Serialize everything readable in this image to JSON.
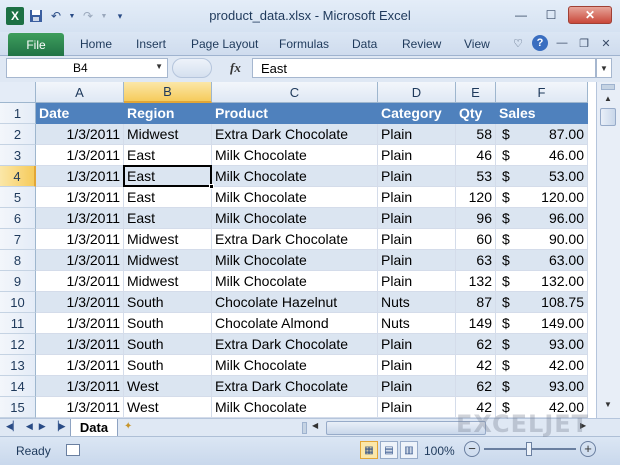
{
  "window": {
    "title": "product_data.xlsx - Microsoft Excel",
    "app_icon": "excel-logo",
    "qat_icons": [
      "save-icon",
      "undo-icon",
      "redo-icon",
      "customize-icon"
    ],
    "buttons": [
      "minimize",
      "maximize",
      "close"
    ]
  },
  "ribbon": {
    "file_label": "File",
    "tabs": [
      "Home",
      "Insert",
      "Page Layout",
      "Formulas",
      "Data",
      "Review",
      "View"
    ]
  },
  "formula_bar": {
    "name_box": "B4",
    "fx": "fx",
    "value": "East"
  },
  "grid": {
    "columns": [
      "A",
      "B",
      "C",
      "D",
      "E",
      "F"
    ],
    "selected_column": "B",
    "selected_row": "4",
    "rows": [
      {
        "n": "1",
        "date": "Date",
        "region": "Region",
        "product": "Product",
        "category": "Category",
        "qty": "Qty",
        "dollar": "",
        "sales": "Sales"
      },
      {
        "n": "2",
        "date": "1/3/2011",
        "region": "Midwest",
        "product": "Extra Dark Chocolate",
        "category": "Plain",
        "qty": "58",
        "dollar": "$",
        "sales": "87.00"
      },
      {
        "n": "3",
        "date": "1/3/2011",
        "region": "East",
        "product": "Milk Chocolate",
        "category": "Plain",
        "qty": "46",
        "dollar": "$",
        "sales": "46.00"
      },
      {
        "n": "4",
        "date": "1/3/2011",
        "region": "East",
        "product": "Milk Chocolate",
        "category": "Plain",
        "qty": "53",
        "dollar": "$",
        "sales": "53.00"
      },
      {
        "n": "5",
        "date": "1/3/2011",
        "region": "East",
        "product": "Milk Chocolate",
        "category": "Plain",
        "qty": "120",
        "dollar": "$",
        "sales": "120.00"
      },
      {
        "n": "6",
        "date": "1/3/2011",
        "region": "East",
        "product": "Milk Chocolate",
        "category": "Plain",
        "qty": "96",
        "dollar": "$",
        "sales": "96.00"
      },
      {
        "n": "7",
        "date": "1/3/2011",
        "region": "Midwest",
        "product": "Extra Dark Chocolate",
        "category": "Plain",
        "qty": "60",
        "dollar": "$",
        "sales": "90.00"
      },
      {
        "n": "8",
        "date": "1/3/2011",
        "region": "Midwest",
        "product": "Milk Chocolate",
        "category": "Plain",
        "qty": "63",
        "dollar": "$",
        "sales": "63.00"
      },
      {
        "n": "9",
        "date": "1/3/2011",
        "region": "Midwest",
        "product": "Milk Chocolate",
        "category": "Plain",
        "qty": "132",
        "dollar": "$",
        "sales": "132.00"
      },
      {
        "n": "10",
        "date": "1/3/2011",
        "region": "South",
        "product": "Chocolate Hazelnut",
        "category": "Nuts",
        "qty": "87",
        "dollar": "$",
        "sales": "108.75"
      },
      {
        "n": "11",
        "date": "1/3/2011",
        "region": "South",
        "product": "Chocolate Almond",
        "category": "Nuts",
        "qty": "149",
        "dollar": "$",
        "sales": "149.00"
      },
      {
        "n": "12",
        "date": "1/3/2011",
        "region": "South",
        "product": "Extra Dark Chocolate",
        "category": "Plain",
        "qty": "62",
        "dollar": "$",
        "sales": "93.00"
      },
      {
        "n": "13",
        "date": "1/3/2011",
        "region": "South",
        "product": "Milk Chocolate",
        "category": "Plain",
        "qty": "42",
        "dollar": "$",
        "sales": "42.00"
      },
      {
        "n": "14",
        "date": "1/3/2011",
        "region": "West",
        "product": "Extra Dark Chocolate",
        "category": "Plain",
        "qty": "62",
        "dollar": "$",
        "sales": "93.00"
      },
      {
        "n": "15",
        "date": "1/3/2011",
        "region": "West",
        "product": "Milk Chocolate",
        "category": "Plain",
        "qty": "42",
        "dollar": "$",
        "sales": "42.00"
      }
    ]
  },
  "sheets": {
    "tabs": [
      "Data"
    ],
    "active": "Data"
  },
  "status": {
    "text": "Ready",
    "zoom": "100%",
    "minus": "−",
    "plus": "+"
  },
  "watermark": "EXCELJET",
  "colors": {
    "header_fill": "#4f81bd",
    "band_fill": "#dbe5f1",
    "selection_highlight": "#f6cb5c",
    "file_tab": "#217346"
  }
}
